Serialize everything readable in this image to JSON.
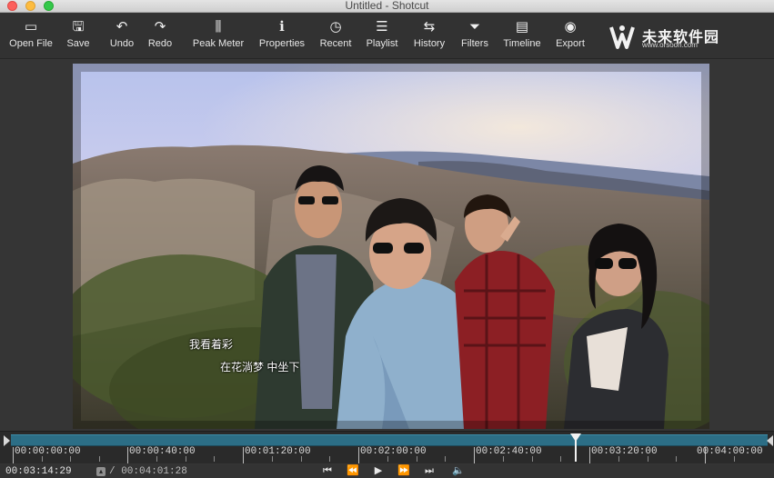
{
  "window": {
    "title": "Untitled - Shotcut"
  },
  "toolbar": {
    "items": [
      {
        "label": "Open File",
        "icon": "folder-open-icon",
        "glyph": "▭"
      },
      {
        "label": "Save",
        "icon": "save-icon",
        "glyph": "🖫"
      },
      {
        "label": "Undo",
        "icon": "undo-icon",
        "glyph": "↶"
      },
      {
        "label": "Redo",
        "icon": "redo-icon",
        "glyph": "↷"
      },
      {
        "label": "Peak Meter",
        "icon": "peak-meter-icon",
        "glyph": "⫼"
      },
      {
        "label": "Properties",
        "icon": "properties-icon",
        "glyph": "ℹ"
      },
      {
        "label": "Recent",
        "icon": "clock-icon",
        "glyph": "◷"
      },
      {
        "label": "Playlist",
        "icon": "playlist-icon",
        "glyph": "☰"
      },
      {
        "label": "History",
        "icon": "history-icon",
        "glyph": "⇆"
      },
      {
        "label": "Filters",
        "icon": "filter-icon",
        "glyph": "⏷"
      },
      {
        "label": "Timeline",
        "icon": "timeline-icon",
        "glyph": "▤"
      },
      {
        "label": "Export",
        "icon": "export-icon",
        "glyph": "◉"
      }
    ]
  },
  "watermark": {
    "name": "未来软件园",
    "url": "www.orsoon.com"
  },
  "video": {
    "subtitle_line1": "我看着彩",
    "subtitle_line2": "在花淌梦 中坐下"
  },
  "scrubber": {
    "ticks": [
      "00:00:00:00",
      "00:00:40:00",
      "00:01:20:00",
      "00:02:00:00",
      "00:02:40:00",
      "00:03:20:00",
      "00:04:00:00"
    ],
    "track_color": "#2c6e86"
  },
  "transport": {
    "current_timecode": "00:03:14:29",
    "duration_timecode": "/ 00:04:01:28",
    "buttons": [
      {
        "name": "skip-to-start-icon",
        "glyph": "⏮"
      },
      {
        "name": "rewind-icon",
        "glyph": "⏪"
      },
      {
        "name": "play-icon",
        "glyph": "▶"
      },
      {
        "name": "fast-forward-icon",
        "glyph": "⏩"
      },
      {
        "name": "skip-to-end-icon",
        "glyph": "⏭"
      },
      {
        "name": "volume-icon",
        "glyph": "🔈"
      }
    ]
  }
}
